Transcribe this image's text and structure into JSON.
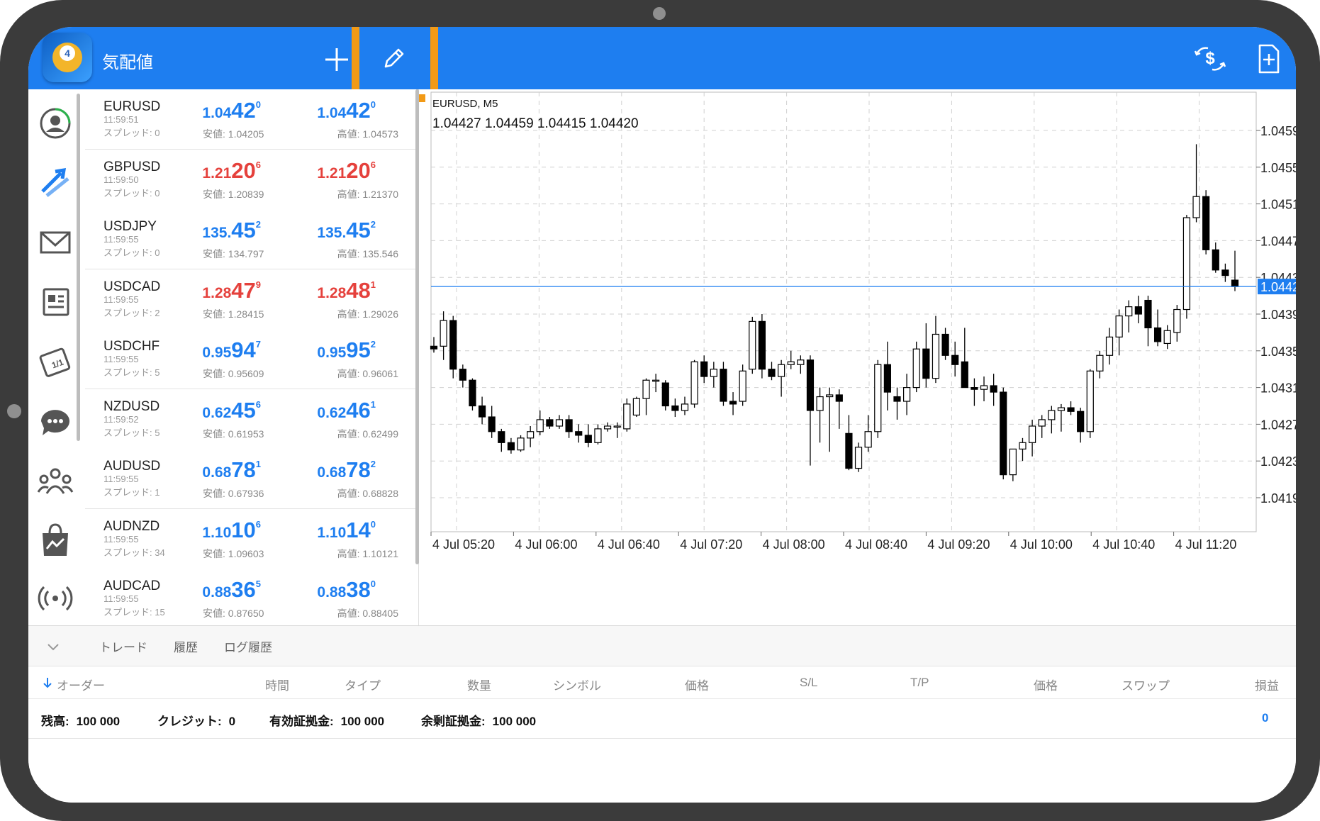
{
  "app": {
    "title": "気配値"
  },
  "toolbar": {
    "add_icon": "plus-icon",
    "edit_icon": "pencil-icon",
    "trade_icon": "currency-swap-icon",
    "new_doc_icon": "add-document-icon"
  },
  "sidebar": {
    "icons": [
      "account-icon",
      "trade-arrows-icon",
      "mail-icon",
      "news-icon",
      "economic-calendar-icon",
      "chat-icon",
      "community-icon",
      "market-bag-icon",
      "signal-icon"
    ]
  },
  "quotes": [
    {
      "symbol": "EURUSD",
      "time": "11:59:51",
      "spread": "スプレッド: 0",
      "bid": {
        "pre": "1.04",
        "big": "42",
        "sup": "0"
      },
      "ask": {
        "pre": "1.04",
        "big": "42",
        "sup": "0"
      },
      "low": "安値: 1.04205",
      "high": "高値: 1.04573",
      "color": "blue"
    },
    {
      "symbol": "GBPUSD",
      "time": "11:59:50",
      "spread": "スプレッド: 0",
      "bid": {
        "pre": "1.21",
        "big": "20",
        "sup": "6"
      },
      "ask": {
        "pre": "1.21",
        "big": "20",
        "sup": "6"
      },
      "low": "安値: 1.20839",
      "high": "高値: 1.21370",
      "color": "red"
    },
    {
      "symbol": "USDJPY",
      "time": "11:59:55",
      "spread": "スプレッド: 0",
      "bid": {
        "pre": "135.",
        "big": "45",
        "sup": "2"
      },
      "ask": {
        "pre": "135.",
        "big": "45",
        "sup": "2"
      },
      "low": "安値: 134.797",
      "high": "高値: 135.546",
      "color": "blue"
    },
    {
      "symbol": "USDCAD",
      "time": "11:59:55",
      "spread": "スプレッド: 2",
      "bid": {
        "pre": "1.28",
        "big": "47",
        "sup": "9"
      },
      "ask": {
        "pre": "1.28",
        "big": "48",
        "sup": "1"
      },
      "low": "安値: 1.28415",
      "high": "高値: 1.29026",
      "color": "red"
    },
    {
      "symbol": "USDCHF",
      "time": "11:59:55",
      "spread": "スプレッド: 5",
      "bid": {
        "pre": "0.95",
        "big": "94",
        "sup": "7"
      },
      "ask": {
        "pre": "0.95",
        "big": "95",
        "sup": "2"
      },
      "low": "安値: 0.95609",
      "high": "高値: 0.96061",
      "color": "blue"
    },
    {
      "symbol": "NZDUSD",
      "time": "11:59:52",
      "spread": "スプレッド: 5",
      "bid": {
        "pre": "0.62",
        "big": "45",
        "sup": "6"
      },
      "ask": {
        "pre": "0.62",
        "big": "46",
        "sup": "1"
      },
      "low": "安値: 0.61953",
      "high": "高値: 0.62499",
      "color": "blue"
    },
    {
      "symbol": "AUDUSD",
      "time": "11:59:55",
      "spread": "スプレッド: 1",
      "bid": {
        "pre": "0.68",
        "big": "78",
        "sup": "1"
      },
      "ask": {
        "pre": "0.68",
        "big": "78",
        "sup": "2"
      },
      "low": "安値: 0.67936",
      "high": "高値: 0.68828",
      "color": "blue"
    },
    {
      "symbol": "AUDNZD",
      "time": "11:59:55",
      "spread": "スプレッド: 34",
      "bid": {
        "pre": "1.10",
        "big": "10",
        "sup": "6"
      },
      "ask": {
        "pre": "1.10",
        "big": "14",
        "sup": "0"
      },
      "low": "安値: 1.09603",
      "high": "高値: 1.10121",
      "color": "blue"
    },
    {
      "symbol": "AUDCAD",
      "time": "11:59:55",
      "spread": "スプレッド: 15",
      "bid": {
        "pre": "0.88",
        "big": "36",
        "sup": "5"
      },
      "ask": {
        "pre": "0.88",
        "big": "38",
        "sup": "0"
      },
      "low": "安値: 0.87650",
      "high": "高値: 0.88405",
      "color": "blue"
    }
  ],
  "chart": {
    "title": "EURUSD, M5",
    "ohlc": "1.04427 1.04459 1.04415 1.04420"
  },
  "chart_data": {
    "type": "candlestick",
    "ylim": [
      1.0415,
      1.0462
    ],
    "y_ticks": [
      "1.04590",
      "1.04550",
      "1.04510",
      "1.04470",
      "1.04430",
      "1.04390",
      "1.04350",
      "1.04310",
      "1.04270",
      "1.04230",
      "1.04190"
    ],
    "x_ticks": [
      "4 Jul 05:20",
      "4 Jul 06:00",
      "4 Jul 06:40",
      "4 Jul 07:20",
      "4 Jul 08:00",
      "4 Jul 08:40",
      "4 Jul 09:20",
      "4 Jul 10:00",
      "4 Jul 10:40",
      "4 Jul 11:20"
    ],
    "current_price": "1.04420",
    "current_price_color": "#1e7ef0",
    "grid": true,
    "candles": [
      [
        1.04355,
        1.04365,
        1.04348,
        1.04352
      ],
      [
        1.04355,
        1.04393,
        1.0434,
        1.04383
      ],
      [
        1.04383,
        1.04388,
        1.0432,
        1.0433
      ],
      [
        1.0433,
        1.04335,
        1.0431,
        1.04318
      ],
      [
        1.04318,
        1.0432,
        1.04285,
        1.0429
      ],
      [
        1.0429,
        1.043,
        1.0427,
        1.04278
      ],
      [
        1.04278,
        1.0429,
        1.04255,
        1.04262
      ],
      [
        1.04262,
        1.04265,
        1.0424,
        1.0425
      ],
      [
        1.0425,
        1.04255,
        1.04238,
        1.04242
      ],
      [
        1.04242,
        1.04258,
        1.0424,
        1.04255
      ],
      [
        1.04255,
        1.04268,
        1.04245,
        1.04262
      ],
      [
        1.04262,
        1.04285,
        1.04258,
        1.04275
      ],
      [
        1.04275,
        1.04278,
        1.04265,
        1.04268
      ],
      [
        1.04268,
        1.0428,
        1.04265,
        1.04275
      ],
      [
        1.04275,
        1.0428,
        1.04255,
        1.04262
      ],
      [
        1.04262,
        1.0427,
        1.0425,
        1.04258
      ],
      [
        1.04258,
        1.0427,
        1.04245,
        1.0425
      ],
      [
        1.0425,
        1.0427,
        1.04248,
        1.04265
      ],
      [
        1.04265,
        1.04272,
        1.04262,
        1.04268
      ],
      [
        1.04268,
        1.04272,
        1.04255,
        1.04268
      ],
      [
        1.04265,
        1.04298,
        1.04262,
        1.04292
      ],
      [
        1.0428,
        1.043,
        1.04278,
        1.04298
      ],
      [
        1.04298,
        1.0432,
        1.0428,
        1.04318
      ],
      [
        1.04318,
        1.04325,
        1.04305,
        1.04318
      ],
      [
        1.04315,
        1.04318,
        1.04285,
        1.0429
      ],
      [
        1.0429,
        1.04298,
        1.04278,
        1.04285
      ],
      [
        1.04285,
        1.043,
        1.0428,
        1.04292
      ],
      [
        1.04292,
        1.0434,
        1.04288,
        1.04338
      ],
      [
        1.04338,
        1.04345,
        1.04315,
        1.04322
      ],
      [
        1.04322,
        1.04338,
        1.0431,
        1.0433
      ],
      [
        1.0433,
        1.04338,
        1.0429,
        1.04295
      ],
      [
        1.04295,
        1.04305,
        1.0428,
        1.04292
      ],
      [
        1.04295,
        1.04335,
        1.0429,
        1.04328
      ],
      [
        1.0433,
        1.04387,
        1.04325,
        1.04382
      ],
      [
        1.04382,
        1.0439,
        1.0432,
        1.0433
      ],
      [
        1.0433,
        1.04338,
        1.04318,
        1.04322
      ],
      [
        1.04322,
        1.0434,
        1.043,
        1.04335
      ],
      [
        1.04335,
        1.0435,
        1.0433,
        1.04338
      ],
      [
        1.04335,
        1.04345,
        1.04325,
        1.0434
      ],
      [
        1.0434,
        1.04345,
        1.04225,
        1.04285
      ],
      [
        1.04285,
        1.0431,
        1.0425,
        1.043
      ],
      [
        1.043,
        1.0431,
        1.0424,
        1.04302
      ],
      [
        1.04302,
        1.04308,
        1.04265,
        1.04295
      ],
      [
        1.0426,
        1.0428,
        1.0422,
        1.04222
      ],
      [
        1.04222,
        1.0425,
        1.04218,
        1.04245
      ],
      [
        1.04245,
        1.0428,
        1.0424,
        1.04262
      ],
      [
        1.04262,
        1.0434,
        1.04255,
        1.04335
      ],
      [
        1.04335,
        1.0436,
        1.04285,
        1.04305
      ],
      [
        1.043,
        1.0431,
        1.04275,
        1.04295
      ],
      [
        1.04295,
        1.04325,
        1.0428,
        1.0431
      ],
      [
        1.0431,
        1.0436,
        1.04305,
        1.04352
      ],
      [
        1.04352,
        1.0438,
        1.0431,
        1.0432
      ],
      [
        1.0432,
        1.04388,
        1.04315,
        1.04368
      ],
      [
        1.04368,
        1.04375,
        1.0434,
        1.04345
      ],
      [
        1.04345,
        1.0436,
        1.04322,
        1.04335
      ],
      [
        1.04338,
        1.04375,
        1.04315,
        1.0431
      ],
      [
        1.0431,
        1.0432,
        1.0429,
        1.04308
      ],
      [
        1.04308,
        1.04322,
        1.04295,
        1.04312
      ],
      [
        1.04312,
        1.04325,
        1.0429,
        1.04305
      ],
      [
        1.04305,
        1.0431,
        1.0421,
        1.04215
      ],
      [
        1.04215,
        1.0424,
        1.04208,
        1.04243
      ],
      [
        1.04243,
        1.04255,
        1.0423,
        1.0425
      ],
      [
        1.0425,
        1.04275,
        1.04235,
        1.04268
      ],
      [
        1.04268,
        1.0428,
        1.04255,
        1.04275
      ],
      [
        1.04275,
        1.0429,
        1.0426,
        1.04285
      ],
      [
        1.04285,
        1.04292,
        1.04262,
        1.04288
      ],
      [
        1.04288,
        1.04295,
        1.0428,
        1.04284
      ],
      [
        1.04284,
        1.04288,
        1.0425,
        1.04262
      ],
      [
        1.04262,
        1.0433,
        1.04255,
        1.04328
      ],
      [
        1.04328,
        1.0435,
        1.0432,
        1.04345
      ],
      [
        1.04345,
        1.04375,
        1.04335,
        1.04365
      ],
      [
        1.04365,
        1.04395,
        1.04345,
        1.04388
      ],
      [
        1.04388,
        1.04405,
        1.0437,
        1.04398
      ],
      [
        1.04398,
        1.0441,
        1.0438,
        1.0439
      ],
      [
        1.04405,
        1.0441,
        1.04355,
        1.04375
      ],
      [
        1.04375,
        1.04395,
        1.04355,
        1.0436
      ],
      [
        1.04358,
        1.04378,
        1.04352,
        1.04372
      ],
      [
        1.0437,
        1.044,
        1.0436,
        1.04395
      ],
      [
        1.04395,
        1.04498,
        1.04385,
        1.04495
      ],
      [
        1.04495,
        1.04575,
        1.0449,
        1.04518
      ],
      [
        1.04518,
        1.04525,
        1.04455,
        1.0446
      ],
      [
        1.0446,
        1.04468,
        1.04435,
        1.04438
      ],
      [
        1.04438,
        1.04445,
        1.04425,
        1.04432
      ],
      [
        1.04427,
        1.04459,
        1.04415,
        1.0442
      ]
    ]
  },
  "bottom": {
    "tabs": [
      "トレード",
      "履歴",
      "ログ履歴"
    ],
    "columns": [
      "オーダー",
      "時間",
      "タイプ",
      "数量",
      "シンボル",
      "価格",
      "S/L",
      "T/P",
      "価格",
      "スワップ",
      "損益"
    ],
    "balance": {
      "label": "残高:",
      "value": "100 000"
    },
    "credit": {
      "label": "クレジット:",
      "value": "0"
    },
    "equity": {
      "label": "有効証拠金:",
      "value": "100 000"
    },
    "free_margin": {
      "label": "余剰証拠金:",
      "value": "100 000"
    },
    "profit": "0"
  }
}
